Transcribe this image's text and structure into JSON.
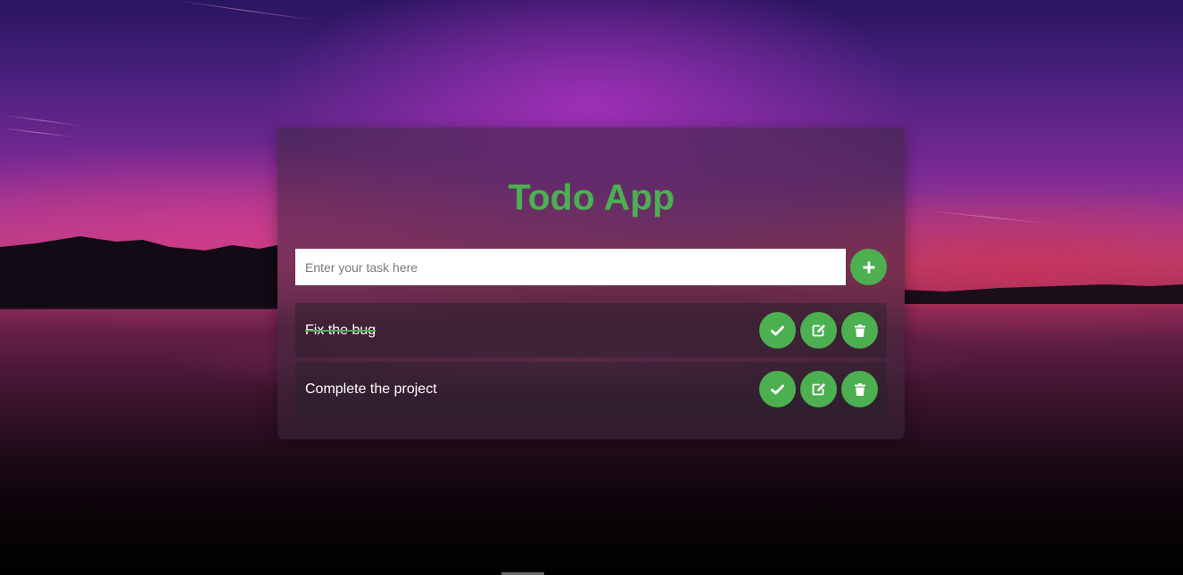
{
  "app": {
    "title": "Todo App"
  },
  "input": {
    "placeholder": "Enter your task here",
    "value": "",
    "add_button_icon": "plus-icon"
  },
  "tasks": [
    {
      "text": "Fix the bug",
      "completed": true,
      "actions": [
        "check-icon",
        "edit-icon",
        "trash-icon"
      ]
    },
    {
      "text": "Complete the project",
      "completed": false,
      "actions": [
        "check-icon",
        "edit-icon",
        "trash-icon"
      ]
    }
  ],
  "colors": {
    "accent": "#4caf50",
    "text": "#ffffff",
    "input_background": "#ffffff"
  }
}
